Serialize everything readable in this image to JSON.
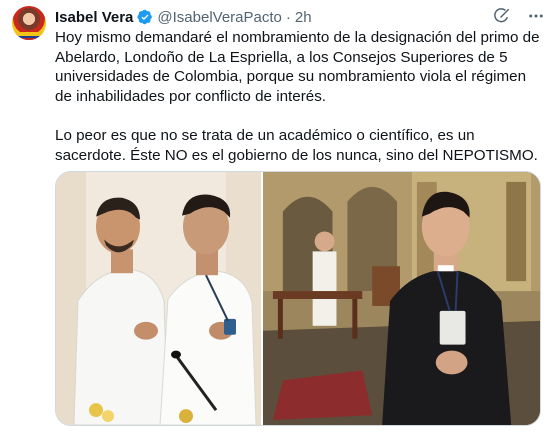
{
  "tweet": {
    "author_name": "Isabel Vera",
    "handle": "@IsabelVeraPacto",
    "separator": "·",
    "time": "2h",
    "paragraphs": [
      "Hoy mismo demandaré el nombramiento de la designación del primo de Abelardo, Londoño de La Espriella, a los Consejos Superiores de 5 universidades de Colombia, porque su nombramiento viola el régimen de inhabilidades por conflicto de interés.",
      "Lo peor es que no se trata de un académico o científico, es un sacerdote. Éste NO es el gobierno de los nunca, sino del NEPOTISMO."
    ]
  },
  "icons": {
    "verified": "verified-badge-icon",
    "grok": "grok-icon",
    "more": "more-options-icon"
  },
  "colors": {
    "verified_blue": "#1d9bf0",
    "text": "#0f1419",
    "secondary": "#536471",
    "border": "#cfd9de"
  }
}
